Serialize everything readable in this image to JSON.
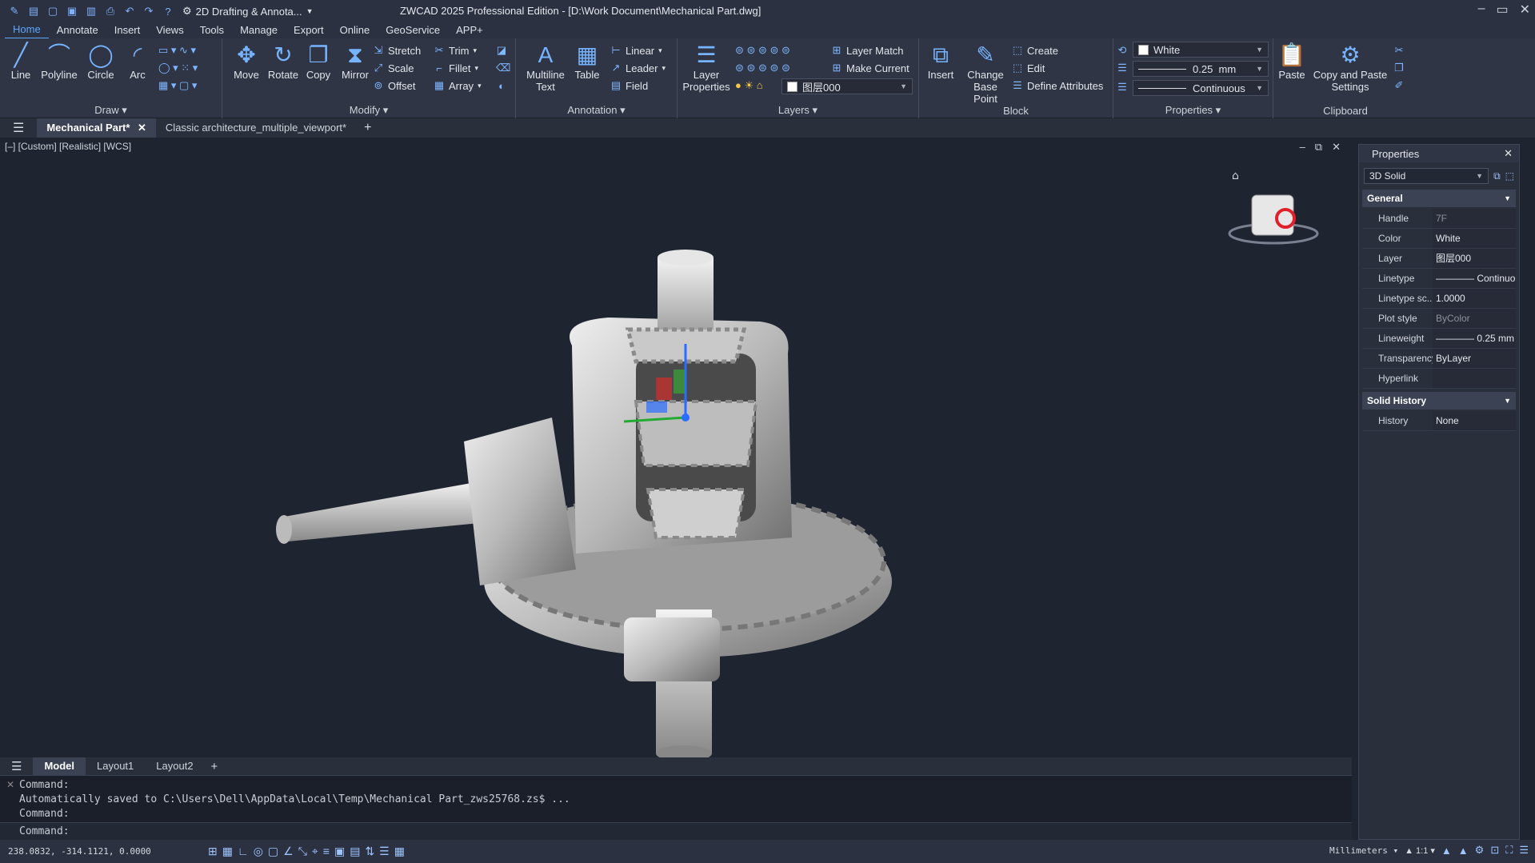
{
  "title_bar": {
    "workspace": "2D Drafting & Annota...",
    "title": "ZWCAD 2025 Professional Edition - [D:\\Work Document\\Mechanical Part.dwg]"
  },
  "menu": [
    "Home",
    "Annotate",
    "Insert",
    "Views",
    "Tools",
    "Manage",
    "Export",
    "Online",
    "GeoService",
    "APP+"
  ],
  "ribbon": {
    "draw": {
      "label": "Draw",
      "line": "Line",
      "polyline": "Polyline",
      "circle": "Circle",
      "arc": "Arc"
    },
    "modify": {
      "label": "Modify",
      "move": "Move",
      "rotate": "Rotate",
      "copy": "Copy",
      "mirror": "Mirror",
      "stretch": "Stretch",
      "scale": "Scale",
      "offset": "Offset",
      "trim": "Trim",
      "fillet": "Fillet",
      "array": "Array"
    },
    "annotation": {
      "label": "Annotation",
      "mtext": "Multiline Text",
      "table": "Table",
      "linear": "Linear",
      "leader": "Leader",
      "field": "Field"
    },
    "layers": {
      "label": "Layers",
      "layer_props": "Layer Properties",
      "layer_match": "Layer Match",
      "make_current": "Make Current",
      "current_layer": "图层000"
    },
    "block": {
      "label": "Block",
      "insert": "Insert",
      "change_base": "Change Base Point",
      "create": "Create",
      "edit": "Edit",
      "define_attr": "Define Attributes"
    },
    "properties": {
      "label": "Properties",
      "color": "White",
      "lineweight": "0.25",
      "lw_unit": "mm",
      "linetype": "Continuous"
    },
    "clipboard": {
      "label": "Clipboard",
      "paste": "Paste",
      "copy_paste": "Copy and Paste Settings"
    }
  },
  "doc_tabs": [
    "Mechanical Part*",
    "Classic architecture_multiple_viewport*"
  ],
  "viewport": {
    "label": "[–] [Custom] [Realistic] [WCS]"
  },
  "properties_panel": {
    "title": "Properties",
    "selection": "3D Solid",
    "general": "General",
    "rows": [
      {
        "k": "Handle",
        "v": "7F",
        "dim": true
      },
      {
        "k": "Color",
        "v": "White",
        "dim": false
      },
      {
        "k": "Layer",
        "v": "图层000",
        "dim": false
      },
      {
        "k": "Linetype",
        "v": "———— Continuo",
        "dim": false
      },
      {
        "k": "Linetype sc...",
        "v": "1.0000",
        "dim": false
      },
      {
        "k": "Plot style",
        "v": "ByColor",
        "dim": true
      },
      {
        "k": "Lineweight",
        "v": "———— 0.25 mm",
        "dim": false
      },
      {
        "k": "Transparency",
        "v": "ByLayer",
        "dim": false
      },
      {
        "k": "Hyperlink",
        "v": "",
        "dim": false
      }
    ],
    "solid_history": "Solid History",
    "history_rows": [
      {
        "k": "History",
        "v": "None",
        "dim": false
      }
    ]
  },
  "layout_tabs": [
    "Model",
    "Layout1",
    "Layout2"
  ],
  "command": {
    "line1": "Command:",
    "line2": "Automatically saved to C:\\Users\\Dell\\AppData\\Local\\Temp\\Mechanical Part_zws25768.zs$ ...",
    "line3": "Command:",
    "prompt": "Command:"
  },
  "status": {
    "coords": "238.0832, -314.1121, 0.0000",
    "units": "Millimeters",
    "scale": "1:1"
  }
}
